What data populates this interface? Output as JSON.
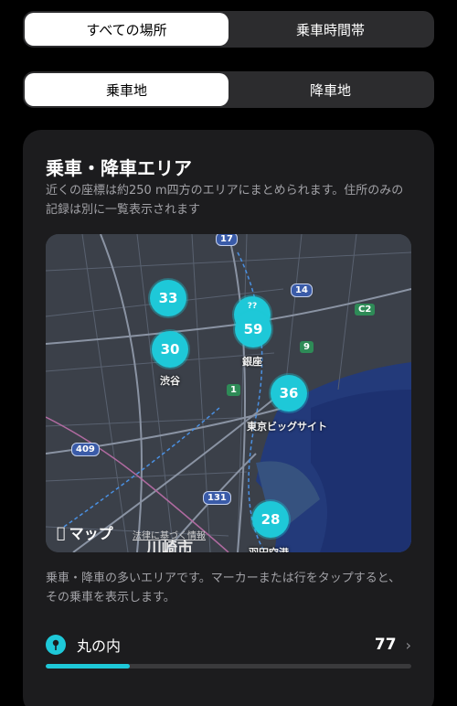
{
  "segment_scope": {
    "options": [
      "すべての場所",
      "乗車時間帯"
    ],
    "selected": 0
  },
  "segment_type": {
    "options": [
      "乗車地",
      "降車地"
    ],
    "selected": 0
  },
  "card": {
    "title": "乗車・降車エリア",
    "description": "近くの座標は約250 m四方のエリアにまとめられます。住所のみの記録は別に一覧表示されます"
  },
  "map": {
    "clusters": [
      {
        "count": "33",
        "label": ""
      },
      {
        "count": "30",
        "label": "渋谷"
      },
      {
        "count": "59",
        "label": "銀座"
      },
      {
        "count": "36",
        "label": "東京ビッグサイト"
      },
      {
        "count": "28",
        "label": "羽田空港"
      }
    ],
    "hidden_cluster_label": "??",
    "road_shields": [
      "17",
      "14",
      "C2",
      "9",
      "1",
      "409",
      "131"
    ],
    "brand": "マップ",
    "legal": "法律に基づく情報",
    "city": "川崎市"
  },
  "note": "乗車・降車の多いエリアです。マーカーまたは行をタップすると、その乗車を表示します。",
  "top_area": {
    "name": "丸の内",
    "count": "77",
    "share": 0.23
  },
  "colors": {
    "accent": "#1ec8d8",
    "card": "#1c1c1e",
    "segment": "#2c2c2e"
  }
}
